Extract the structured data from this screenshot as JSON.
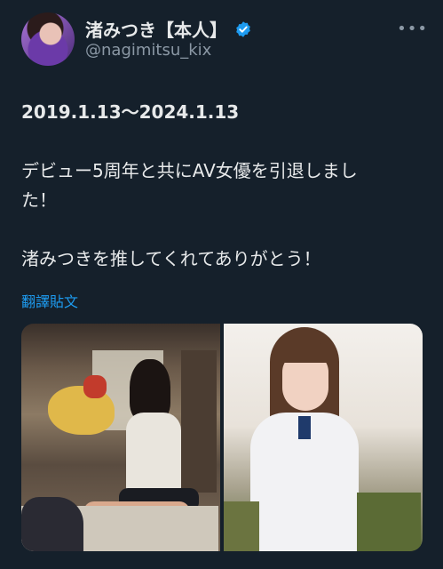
{
  "profile": {
    "display_name": "渚みつき【本人】",
    "handle": "@nagimitsu_kix",
    "more_label": "•••"
  },
  "tweet": {
    "line_date": "2019.1.13〜2024.1.13",
    "line_announce_1": "デビュー5周年と共にAV女優を引退しまし",
    "line_announce_2": "た！",
    "line_thanks": "渚みつきを推してくれてありがとう！"
  },
  "translate_label": "翻譯貼文",
  "colors": {
    "background": "#15202b",
    "text": "#e7e9ea",
    "secondary": "#8b98a5",
    "accent": "#1d9bf0"
  }
}
